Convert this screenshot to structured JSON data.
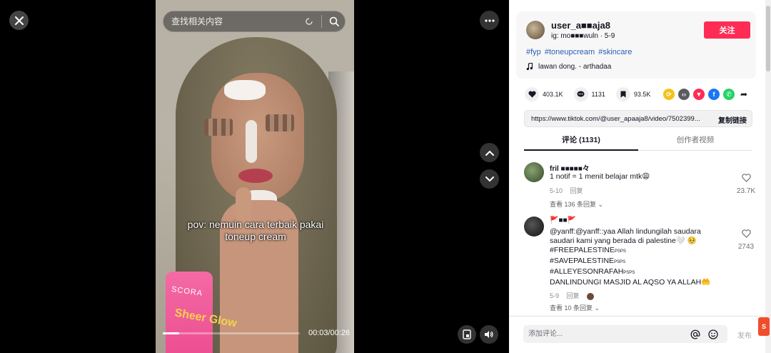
{
  "search": {
    "placeholder": "查找相关内容"
  },
  "video": {
    "caption_line1": "pov: nemuin cara terbaik pakai",
    "caption_line2": "toneup cream",
    "time": "00:03/00:26",
    "progress": 0.12,
    "product_brand": "SCORA",
    "product_text": "Sheer Glow"
  },
  "author": {
    "username": "user_a■■aja8",
    "subline": "ig: mo■■■wuln · 5-9",
    "follow_label": "关注",
    "hashtags": [
      "#fyp",
      "#toneupcream",
      "#skincare"
    ],
    "music": "lawan dong. - arthadaa"
  },
  "stats": {
    "likes": "403.1K",
    "comments": "1131",
    "saves": "93.5K"
  },
  "share_icons": [
    "repost-icon",
    "embed-icon",
    "send-icon",
    "facebook-icon",
    "whatsapp-icon",
    "share-arrow-icon"
  ],
  "link": {
    "url": "https://www.tiktok.com/@user_apaaja8/video/7502399...",
    "copy_label": "复制链接"
  },
  "tabs": {
    "comments": "评论 (1131)",
    "creator": "创作者视频"
  },
  "comments": [
    {
      "name": "fril ■■■■■々",
      "text": "1 notif = 1 menit belajar mtk😩",
      "date": "5-10",
      "reply": "回复",
      "likes": "23.7K",
      "more": "查看 136 条回复 ⌄"
    },
    {
      "name": "🚩■■🚩",
      "lines": [
        "@yanff:@yanff::yaa Allah lindungilah saudara",
        "saudari kami yang berada di palestine🤍 🥺",
        "#FREEPALESTINE",
        "#SAVEPALESTINE",
        "#ALLEYESONRAFAH",
        "DANLINDUNGI MASJID AL AQSO YA ALLAH🤲"
      ],
      "line_suffix": "PSPS",
      "date": "5-9",
      "reply": "回复",
      "likes": "2743",
      "more": "查看 10 条回复 ⌄"
    }
  ],
  "composer": {
    "placeholder": "添加评论...",
    "post_label": "发布"
  },
  "colors": {
    "accent": "#fe2c55",
    "link": "#2b5db9"
  }
}
